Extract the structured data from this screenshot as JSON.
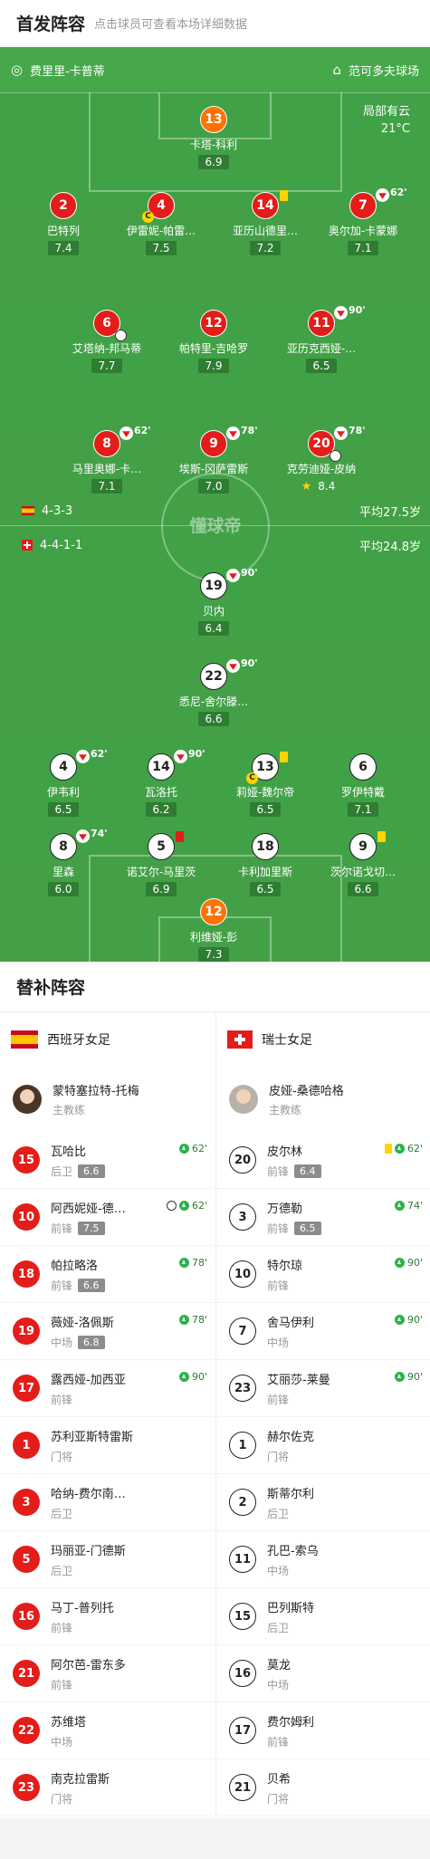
{
  "header": {
    "title": "首发阵容",
    "subtitle": "点击球员可查看本场详细数据"
  },
  "match_info": {
    "referee": "费里里-卡普蒂",
    "stadium": "范可多夫球场",
    "weather": "局部有云",
    "temperature": "21°C"
  },
  "watermark": "懂球帝",
  "home": {
    "formation": "4-3-3",
    "avg_age": "平均27.5岁",
    "flag": "spain-flag-icon",
    "players": [
      {
        "num": "13",
        "name": "卡塔-科利",
        "rating": "6.9",
        "color": "org"
      },
      {
        "num": "2",
        "name": "巴特列",
        "rating": "7.4"
      },
      {
        "num": "4",
        "name": "伊雷妮-帕雷…",
        "rating": "7.5",
        "captain": "C"
      },
      {
        "num": "14",
        "name": "亚历山德里…",
        "rating": "7.2",
        "yellow": true
      },
      {
        "num": "7",
        "name": "奥尔加-卡蒙娜",
        "rating": "7.1",
        "sub": "62'"
      },
      {
        "num": "6",
        "name": "艾塔纳-邦马蒂",
        "rating": "7.7",
        "ball": true
      },
      {
        "num": "12",
        "name": "帕特里-吉哈罗",
        "rating": "7.9"
      },
      {
        "num": "11",
        "name": "亚历克西娅-…",
        "rating": "6.5",
        "sub": "90'"
      },
      {
        "num": "8",
        "name": "马里奥娜-卡…",
        "rating": "7.1",
        "sub": "62'"
      },
      {
        "num": "9",
        "name": "埃斯-冈萨雷斯",
        "rating": "7.0",
        "sub": "78'"
      },
      {
        "num": "20",
        "name": "克劳迪娅-皮纳",
        "rating": "8.4",
        "sub": "78'",
        "ball": true,
        "star": true
      }
    ]
  },
  "away": {
    "formation": "4-4-1-1",
    "avg_age": "平均24.8岁",
    "flag": "switzerland-flag-icon",
    "players": [
      {
        "num": "19",
        "name": "贝内",
        "rating": "6.4",
        "sub": "90'"
      },
      {
        "num": "22",
        "name": "悉尼-舍尔滕…",
        "rating": "6.6",
        "sub": "90'"
      },
      {
        "num": "4",
        "name": "伊韦利",
        "rating": "6.5",
        "sub": "62'"
      },
      {
        "num": "14",
        "name": "瓦洛托",
        "rating": "6.2",
        "sub": "90'"
      },
      {
        "num": "13",
        "name": "莉娅-魏尔帝",
        "rating": "6.5",
        "yellow": true,
        "captain": "C"
      },
      {
        "num": "6",
        "name": "罗伊特戴",
        "rating": "7.1"
      },
      {
        "num": "8",
        "name": "里森",
        "rating": "6.0",
        "sub": "74'"
      },
      {
        "num": "5",
        "name": "诺艾尔-马里茨",
        "rating": "6.9",
        "red": true
      },
      {
        "num": "18",
        "name": "卡利加里斯",
        "rating": "6.5"
      },
      {
        "num": "9",
        "name": "茨尔诺戈切…",
        "rating": "6.6",
        "yellow": true
      },
      {
        "num": "12",
        "name": "利维娅-彭",
        "rating": "7.3",
        "color": "org"
      }
    ]
  },
  "subs": {
    "title": "替补阵容",
    "home": {
      "team": "西班牙女足",
      "coach_name": "蒙特塞拉特-托梅",
      "coach_role": "主教练",
      "players": [
        {
          "num": "15",
          "name": "瓦哈比",
          "pos": "后卫",
          "rating": "6.6",
          "in": "62'"
        },
        {
          "num": "10",
          "name": "阿西妮娅-德…",
          "pos": "前锋",
          "rating": "7.5",
          "in": "62'",
          "ball": true
        },
        {
          "num": "18",
          "name": "帕拉略洛",
          "pos": "前锋",
          "rating": "6.6",
          "in": "78'"
        },
        {
          "num": "19",
          "name": "薇娅-洛佩斯",
          "pos": "中场",
          "rating": "6.8",
          "in": "78'"
        },
        {
          "num": "17",
          "name": "露西娅-加西亚",
          "pos": "前锋",
          "in": "90'"
        },
        {
          "num": "1",
          "name": "苏利亚斯特雷斯",
          "pos": "门将"
        },
        {
          "num": "3",
          "name": "哈纳-费尔南…",
          "pos": "后卫"
        },
        {
          "num": "5",
          "name": "玛丽亚-门德斯",
          "pos": "后卫"
        },
        {
          "num": "16",
          "name": "马丁-普列托",
          "pos": "前锋"
        },
        {
          "num": "21",
          "name": "阿尔芭-雷东多",
          "pos": "前锋"
        },
        {
          "num": "22",
          "name": "苏维塔",
          "pos": "中场"
        },
        {
          "num": "23",
          "name": "南克拉雷斯",
          "pos": "门将"
        }
      ]
    },
    "away": {
      "team": "瑞士女足",
      "coach_name": "皮娅-桑德哈格",
      "coach_role": "主教练",
      "players": [
        {
          "num": "20",
          "name": "皮尔林",
          "pos": "前锋",
          "rating": "6.4",
          "in": "62'",
          "yellow": true
        },
        {
          "num": "3",
          "name": "万德勒",
          "pos": "前锋",
          "rating": "6.5",
          "in": "74'"
        },
        {
          "num": "10",
          "name": "特尔琼",
          "pos": "前锋",
          "in": "90'"
        },
        {
          "num": "7",
          "name": "舍马伊利",
          "pos": "中场",
          "in": "90'"
        },
        {
          "num": "23",
          "name": "艾丽莎-莱曼",
          "pos": "前锋",
          "in": "90'"
        },
        {
          "num": "1",
          "name": "赫尔佐克",
          "pos": "门将"
        },
        {
          "num": "2",
          "name": "斯蒂尔利",
          "pos": "后卫"
        },
        {
          "num": "11",
          "name": "孔巴-索乌",
          "pos": "中场"
        },
        {
          "num": "15",
          "name": "巴列斯特",
          "pos": "后卫"
        },
        {
          "num": "16",
          "name": "莫龙",
          "pos": "中场"
        },
        {
          "num": "17",
          "name": "费尔姆利",
          "pos": "前锋"
        },
        {
          "num": "21",
          "name": "贝希",
          "pos": "门将"
        }
      ]
    }
  },
  "colors": {
    "pitch": "#43a047",
    "home_red": "#e31d1a",
    "keeper_orange": "#ff7300",
    "rating_bg": "#2e7d32"
  }
}
